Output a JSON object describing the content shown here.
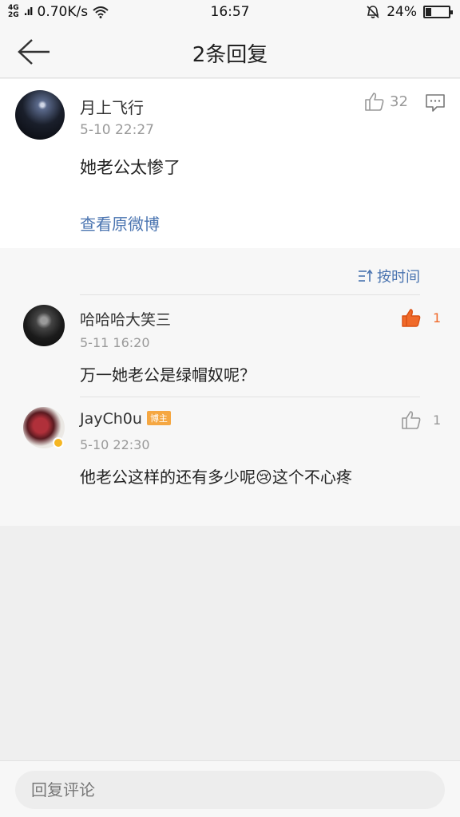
{
  "status_bar": {
    "network": "4G\n2G",
    "speed": "0.70K/s",
    "time": "16:57",
    "battery": "24%",
    "battery_level": 0.24
  },
  "header": {
    "title": "2条回复"
  },
  "main_comment": {
    "username": "月上飞行",
    "time": "5-10 22:27",
    "text": "她老公太惨了",
    "likes": "32",
    "view_original": "查看原微博"
  },
  "sort_label": "按时间",
  "replies": [
    {
      "username": "哈哈哈大笑三",
      "time": "5-11 16:20",
      "text": "万一她老公是绿帽奴呢？",
      "likes": "1",
      "liked": true
    },
    {
      "username": "JayCh0u",
      "badge": "博主",
      "time": "5-10 22:30",
      "text": "他老公这样的还有多少呢😢这个不心疼",
      "likes": "1",
      "liked": false
    }
  ],
  "reply_input": {
    "placeholder": "回复评论"
  },
  "colors": {
    "link": "#4a74b0",
    "like_active": "#f06a2a",
    "badge": "#f5a742"
  }
}
